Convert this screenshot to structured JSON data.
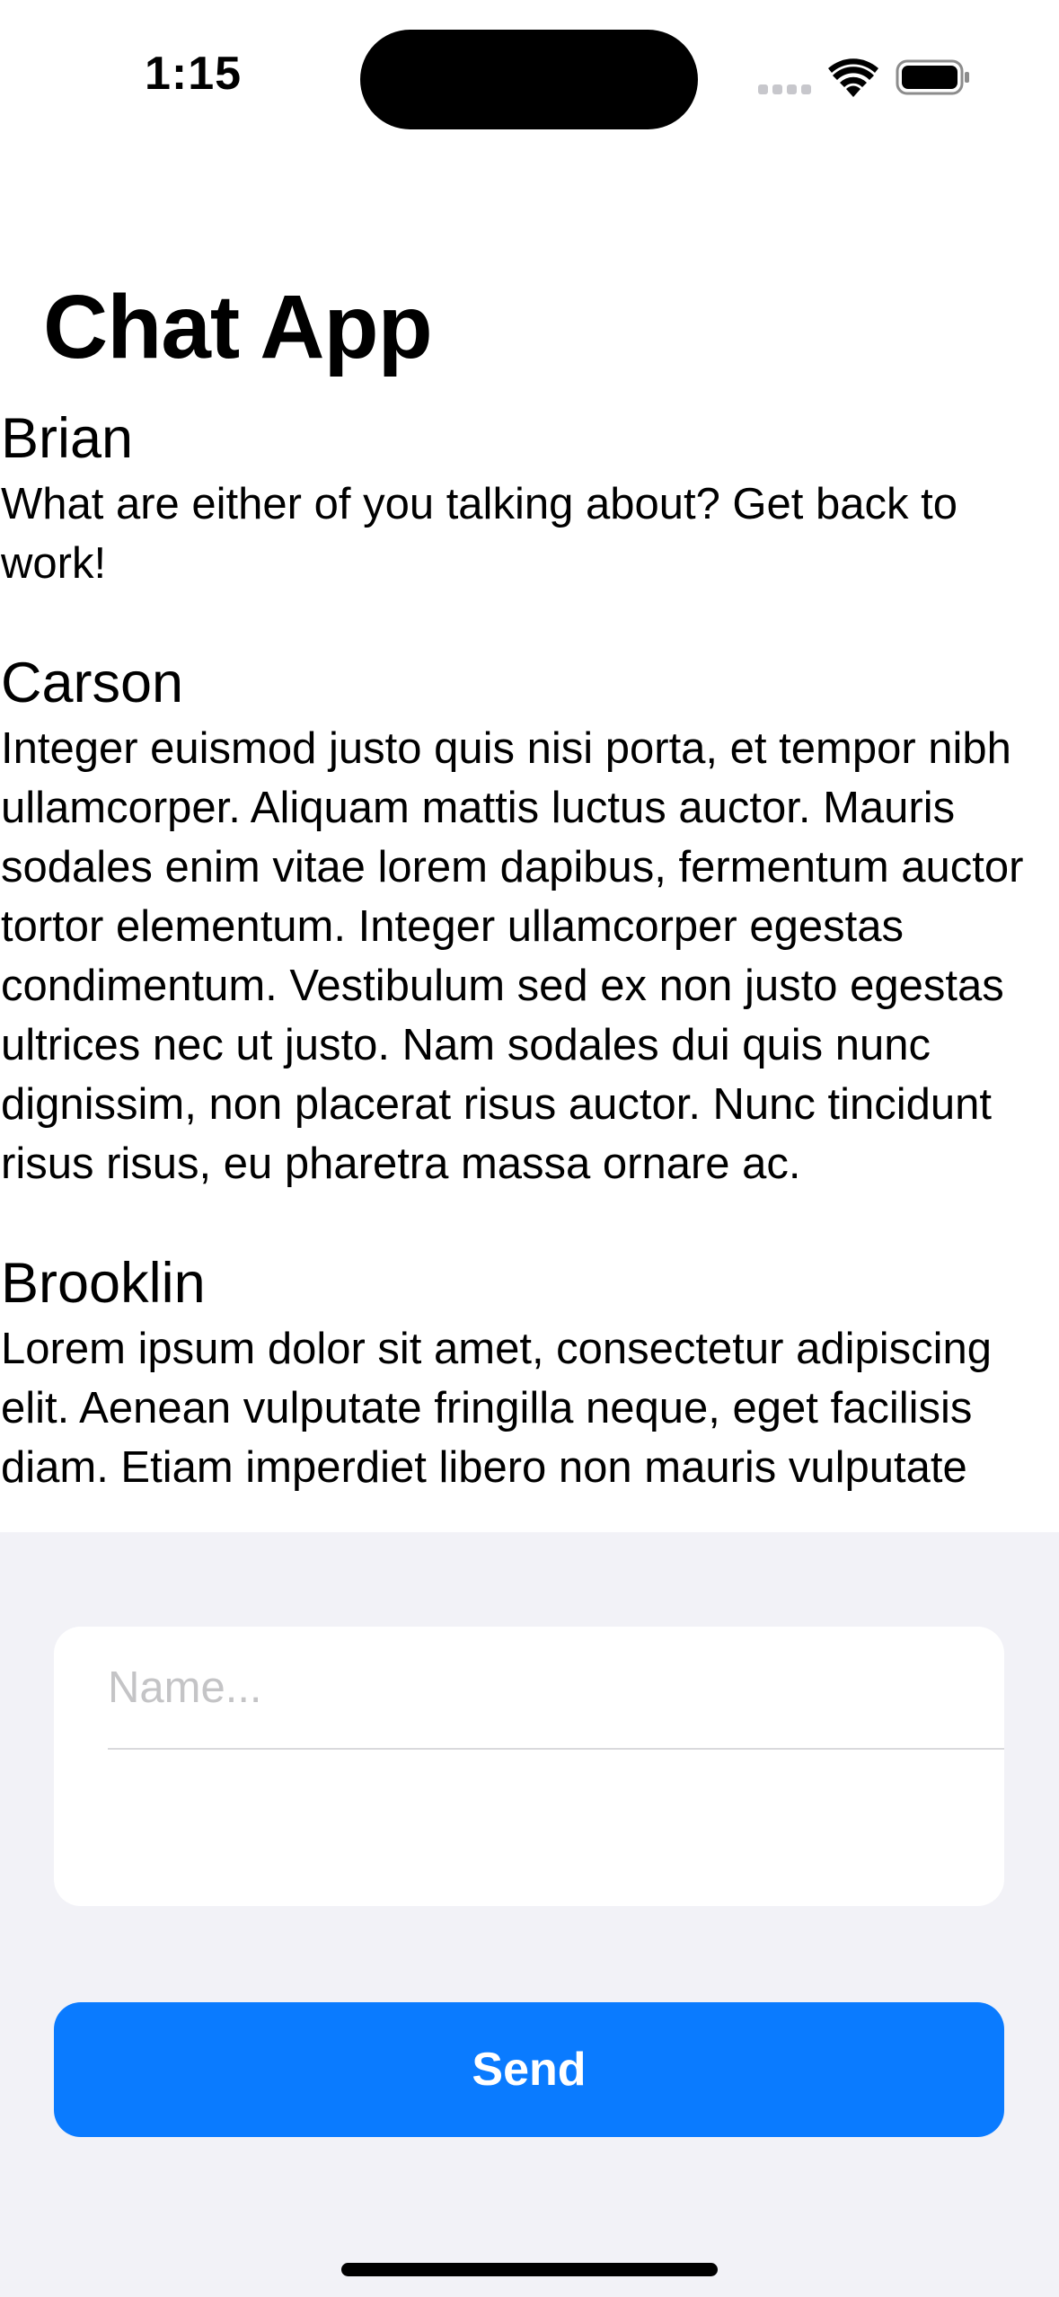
{
  "status_bar": {
    "time": "1:15",
    "icons": [
      "cellular-signal-icon",
      "wifi-icon",
      "battery-icon"
    ]
  },
  "page": {
    "title": "Chat App"
  },
  "messages": [
    {
      "author": "Brian",
      "text": "What are either of you talking about? Get back to work!"
    },
    {
      "author": "Carson",
      "text": "Integer euismod justo quis nisi porta, et tempor nibh ullamcorper. Aliquam mattis luctus auctor. Mauris sodales enim vitae lorem dapibus, fermentum auctor tortor elementum. Integer ullamcorper egestas condimentum. Vestibulum sed ex non justo egestas ultrices nec ut justo. Nam sodales dui quis nunc dignissim, non placerat risus auctor. Nunc tincidunt risus risus, eu pharetra massa ornare ac."
    },
    {
      "author": "Brooklin",
      "text": "Lorem ipsum dolor sit amet, consectetur adipiscing elit. Aenean vulputate fringilla neque, eget facilisis diam. Etiam imperdiet libero non mauris vulputate"
    }
  ],
  "compose": {
    "name_placeholder": "Name...",
    "name_value": "",
    "message_value": "",
    "send_label": "Send"
  },
  "colors": {
    "accent": "#0a7bff",
    "panel_background": "#f2f2f7",
    "placeholder": "#c4c4c6"
  }
}
